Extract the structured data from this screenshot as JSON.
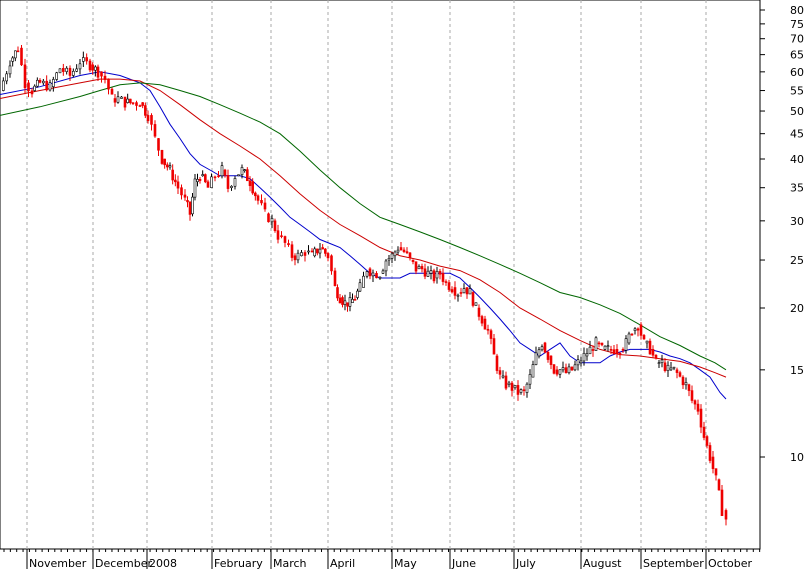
{
  "chart_data": {
    "type": "line",
    "title": "",
    "xlabel": "",
    "ylabel": "",
    "y_scale": "log",
    "ylim": [
      7,
      82
    ],
    "grid": true,
    "legend": "none",
    "y_ticks": [
      80,
      75,
      70,
      65,
      60,
      55,
      50,
      45,
      40,
      35,
      30,
      25,
      20,
      15,
      10
    ],
    "x_ticks": [
      {
        "label": "November",
        "x": 27
      },
      {
        "label": "December",
        "x": 93
      },
      {
        "label": "2008",
        "x": 147
      },
      {
        "label": "February",
        "x": 212
      },
      {
        "label": "March",
        "x": 271
      },
      {
        "label": "April",
        "x": 328
      },
      {
        "label": "May",
        "x": 392
      },
      {
        "label": "June",
        "x": 450
      },
      {
        "label": "July",
        "x": 514
      },
      {
        "label": "August",
        "x": 581
      },
      {
        "label": "September",
        "x": 641
      },
      {
        "label": "October",
        "x": 706
      }
    ],
    "x_range": [
      0,
      760
    ],
    "price": {
      "x": [
        0,
        10,
        18,
        25,
        32,
        40,
        50,
        60,
        70,
        80,
        90,
        98,
        105,
        112,
        118,
        125,
        133,
        140,
        148,
        155,
        162,
        170,
        178,
        185,
        190,
        195,
        200,
        208,
        215,
        222,
        228,
        235,
        242,
        250,
        258,
        265,
        272,
        278,
        285,
        292,
        298,
        305,
        312,
        320,
        328,
        335,
        340,
        345,
        350,
        355,
        360,
        367,
        373,
        380,
        386,
        392,
        398,
        404,
        410,
        416,
        422,
        428,
        434,
        440,
        446,
        452,
        458,
        464,
        470,
        476,
        482,
        488,
        494,
        500,
        506,
        512,
        518,
        524,
        530,
        536,
        542,
        548,
        554,
        560,
        566,
        572,
        578,
        584,
        590,
        596,
        602,
        608,
        614,
        620,
        626,
        632,
        638,
        644,
        650,
        656,
        662,
        668,
        674,
        680,
        686,
        692,
        698,
        704,
        710,
        716,
        722,
        726
      ],
      "values": [
        55,
        63,
        67,
        57,
        55,
        57,
        56,
        61,
        59,
        63,
        62,
        60,
        58,
        53,
        53,
        52,
        52,
        52,
        49,
        44,
        40,
        38,
        35,
        33,
        31,
        36,
        37,
        35,
        37,
        38,
        35,
        37,
        38,
        36,
        33,
        31,
        30,
        28,
        27,
        25.5,
        25.5,
        26,
        25.5,
        26.5,
        25.5,
        22,
        21,
        20.5,
        20.5,
        21,
        22,
        24,
        23.5,
        23.5,
        25,
        25.5,
        26.5,
        26,
        25,
        24,
        24,
        23.5,
        23,
        23.5,
        22.5,
        22,
        21.5,
        22,
        21.5,
        20,
        19,
        18,
        16,
        14.5,
        14,
        13.8,
        13.5,
        13.5,
        14.5,
        16,
        17,
        16,
        15,
        15,
        14.8,
        15,
        15.5,
        16,
        16.5,
        17,
        16.5,
        16.5,
        16.5,
        16.5,
        17,
        18,
        18.5,
        17,
        16.5,
        15.5,
        15.5,
        15,
        15,
        14.5,
        14,
        13,
        12.5,
        11,
        10,
        9,
        7.8,
        7.5
      ]
    },
    "series": [
      {
        "color": "#0000cc",
        "x": [
          0,
          40,
          80,
          100,
          120,
          140,
          150,
          160,
          170,
          180,
          190,
          200,
          210,
          220,
          230,
          240,
          250,
          260,
          270,
          280,
          290,
          300,
          310,
          320,
          330,
          340,
          350,
          360,
          370,
          380,
          390,
          400,
          410,
          420,
          430,
          440,
          450,
          460,
          470,
          480,
          490,
          500,
          510,
          520,
          530,
          540,
          550,
          560,
          570,
          580,
          590,
          600,
          610,
          620,
          630,
          640,
          650,
          660,
          670,
          680,
          690,
          700,
          710,
          720,
          726
        ],
        "values": [
          54,
          56,
          59,
          60,
          59,
          57,
          55,
          51,
          47,
          44,
          41,
          39,
          38,
          37,
          37,
          37,
          36.5,
          35,
          33.5,
          32,
          30.5,
          29.5,
          28.5,
          27.5,
          27,
          26.5,
          25.5,
          24.5,
          23.5,
          23,
          23,
          23,
          23.5,
          23.5,
          23.5,
          23.5,
          23.5,
          23,
          22,
          21,
          20,
          19,
          18,
          17,
          16.5,
          16,
          16.5,
          17,
          16,
          15.5,
          15.5,
          15.5,
          16,
          16.3,
          16.5,
          16.5,
          16.5,
          16.3,
          16,
          15.8,
          15.5,
          15,
          14.5,
          13.5,
          13.1
        ]
      },
      {
        "color": "#cc0000",
        "x": [
          0,
          40,
          80,
          100,
          120,
          140,
          160,
          180,
          200,
          220,
          240,
          260,
          280,
          300,
          320,
          340,
          360,
          380,
          400,
          420,
          440,
          460,
          480,
          500,
          520,
          540,
          560,
          580,
          600,
          620,
          640,
          660,
          680,
          700,
          715,
          726
        ],
        "values": [
          53,
          55,
          57,
          58,
          58,
          57.5,
          55,
          51.5,
          48,
          45,
          42.5,
          40,
          37,
          34,
          31.5,
          29.5,
          28,
          26.5,
          25.5,
          25,
          24.3,
          23.8,
          22.8,
          21.5,
          20,
          19,
          18,
          17.2,
          16.5,
          16.1,
          16,
          15.8,
          15.6,
          15.2,
          14.8,
          14.5
        ]
      },
      {
        "color": "#006600",
        "x": [
          0,
          40,
          80,
          100,
          120,
          140,
          160,
          180,
          200,
          220,
          240,
          260,
          280,
          300,
          320,
          340,
          360,
          380,
          400,
          420,
          440,
          460,
          480,
          500,
          520,
          540,
          560,
          580,
          600,
          620,
          640,
          660,
          680,
          700,
          715,
          726
        ],
        "values": [
          49,
          51,
          53.5,
          55,
          56.5,
          57,
          56.5,
          55,
          53.5,
          51.5,
          49.5,
          47.5,
          45,
          41.5,
          38,
          35,
          32.5,
          30.5,
          29.5,
          28.5,
          27.5,
          26.5,
          25.5,
          24.5,
          23.5,
          22.5,
          21.5,
          21,
          20.3,
          19.5,
          18.5,
          17.5,
          16.8,
          16,
          15.5,
          15
        ]
      }
    ]
  }
}
